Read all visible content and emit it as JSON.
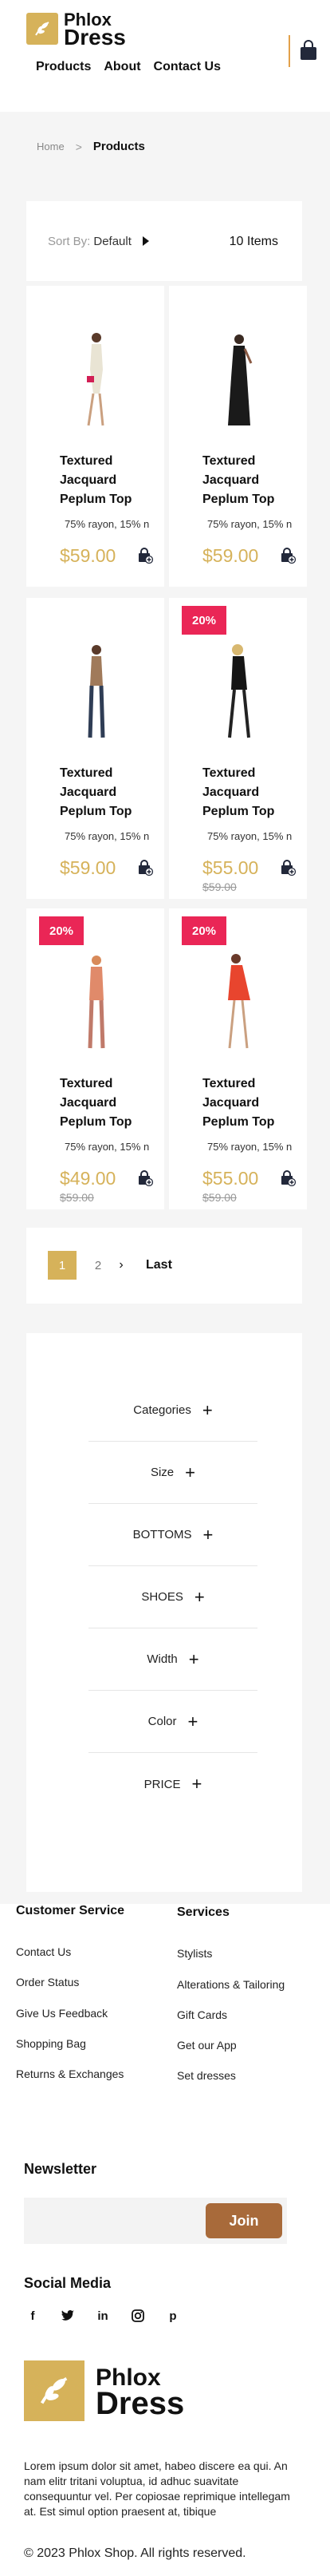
{
  "brand": {
    "line1": "Phlox",
    "line2": "Dress",
    "accent": "#d6b25a"
  },
  "nav": [
    "Products",
    "About",
    "Contact Us"
  ],
  "breadcrumb": {
    "home": "Home",
    "separator": ">",
    "current": "Products"
  },
  "sort": {
    "label": "Sort By:",
    "value": "Default",
    "count": "10 Items"
  },
  "products": [
    {
      "title": "Textured Jacquard Peplum Top",
      "desc": "75% rayon, 15% n",
      "price": "$59.00",
      "old_price": "",
      "badge": ""
    },
    {
      "title": "Textured Jacquard Peplum Top",
      "desc": "75% rayon, 15% n",
      "price": "$59.00",
      "old_price": "",
      "badge": ""
    },
    {
      "title": "Textured Jacquard Peplum Top",
      "desc": "75% rayon, 15% n",
      "price": "$59.00",
      "old_price": "",
      "badge": ""
    },
    {
      "title": "Textured Jacquard Peplum Top",
      "desc": "75% rayon, 15% n",
      "price": "$55.00",
      "old_price": "$59.00",
      "badge": "20%"
    },
    {
      "title": "Textured Jacquard Peplum Top",
      "desc": "75% rayon, 15% n",
      "price": "$49.00",
      "old_price": "$59.00",
      "badge": "20%"
    },
    {
      "title": "Textured Jacquard Peplum Top",
      "desc": "75% rayon, 15% n",
      "price": "$55.00",
      "old_price": "$59.00",
      "badge": "20%"
    }
  ],
  "pagination": {
    "current": "1",
    "next_page": "2",
    "next_icon": "›",
    "last": "Last"
  },
  "filters": [
    "Categories",
    "Size",
    "BOTTOMS",
    "SHOES",
    "Width",
    "Color",
    "PRICE"
  ],
  "filter_plus": "+",
  "footer": {
    "customer_service": {
      "heading": "Customer Service",
      "links": [
        "Contact Us",
        "Order Status",
        "Give Us Feedback",
        "Shopping Bag",
        "Returns & Exchanges"
      ]
    },
    "services": {
      "heading": "Services",
      "links": [
        "Stylists",
        "Alterations & Tailoring",
        "Gift Cards",
        "Get our App",
        "Set dresses"
      ]
    },
    "newsletter": {
      "heading": "Newsletter",
      "placeholder": "",
      "button": "Join"
    },
    "social": {
      "heading": "Social Media",
      "icons": [
        "facebook-icon",
        "twitter-icon",
        "linkedin-icon",
        "instagram-icon",
        "pinterest-icon"
      ]
    },
    "about": "Lorem ipsum dolor sit amet, habeo discere ea qui. An nam elitr tritani voluptua, id adhuc suavitate consequuntur vel. Per copiosae reprimique intellegam at. Est simul option praesent at, tibique",
    "copyright": "© 2023 Phlox Shop. All rights reserved."
  }
}
